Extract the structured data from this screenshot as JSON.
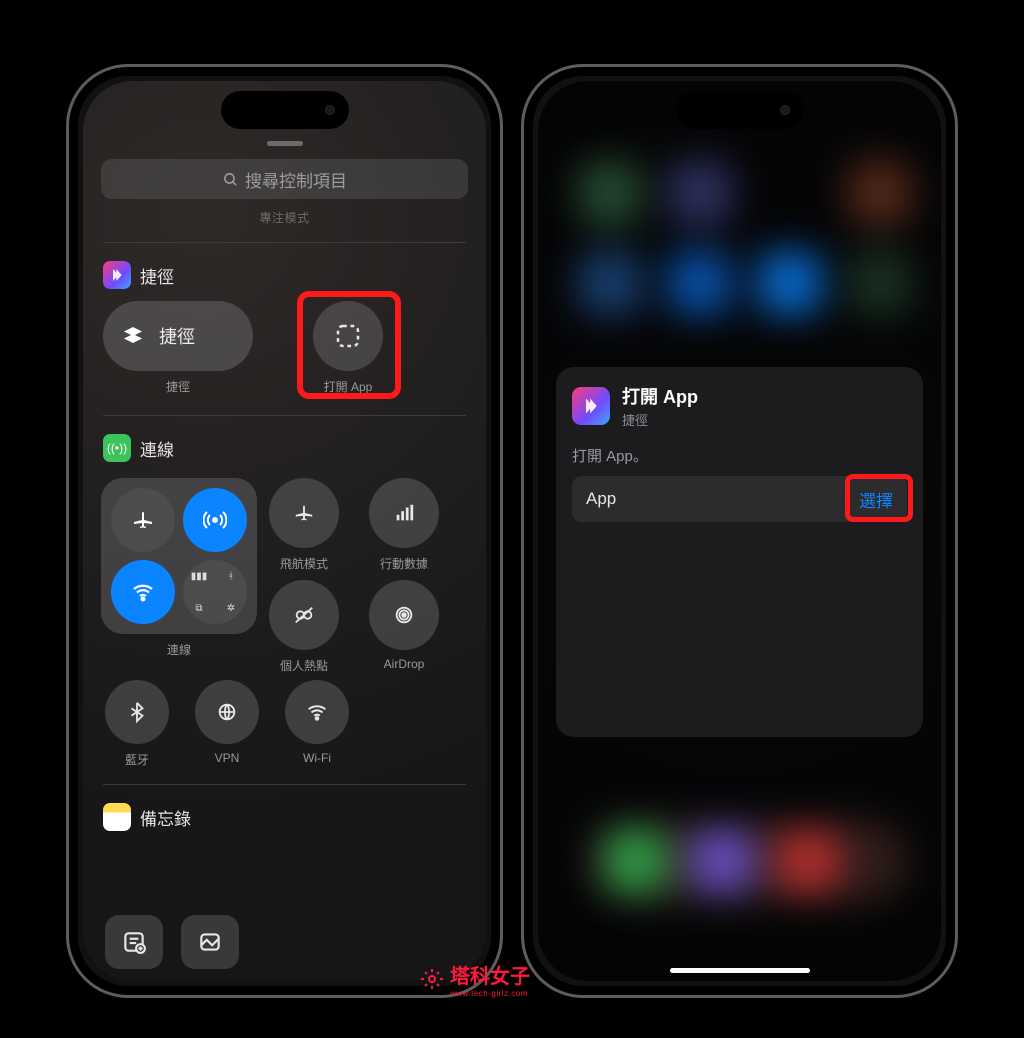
{
  "left": {
    "search_placeholder": "搜尋控制項目",
    "truncated_hint": "專注模式",
    "sections": {
      "shortcuts": {
        "title": "捷徑",
        "tile_shortcut_label": "捷徑",
        "tile_shortcut_caption": "捷徑",
        "tile_openapp_caption": "打開 App"
      },
      "connectivity": {
        "title": "連線",
        "block_caption": "連線",
        "items": {
          "airplane": "飛航模式",
          "cellular": "行動數據",
          "hotspot": "個人熱點",
          "airdrop": "AirDrop",
          "bluetooth": "藍牙",
          "vpn": "VPN",
          "wifi": "Wi-Fi"
        }
      },
      "notes": {
        "title": "備忘錄"
      }
    }
  },
  "right": {
    "card": {
      "title": "打開 App",
      "subtitle": "捷徑",
      "description": "打開 App。",
      "field_label": "App",
      "select_label": "選擇"
    }
  },
  "watermark": {
    "name": "塔科女子",
    "url": "www.tech-girlz.com"
  }
}
